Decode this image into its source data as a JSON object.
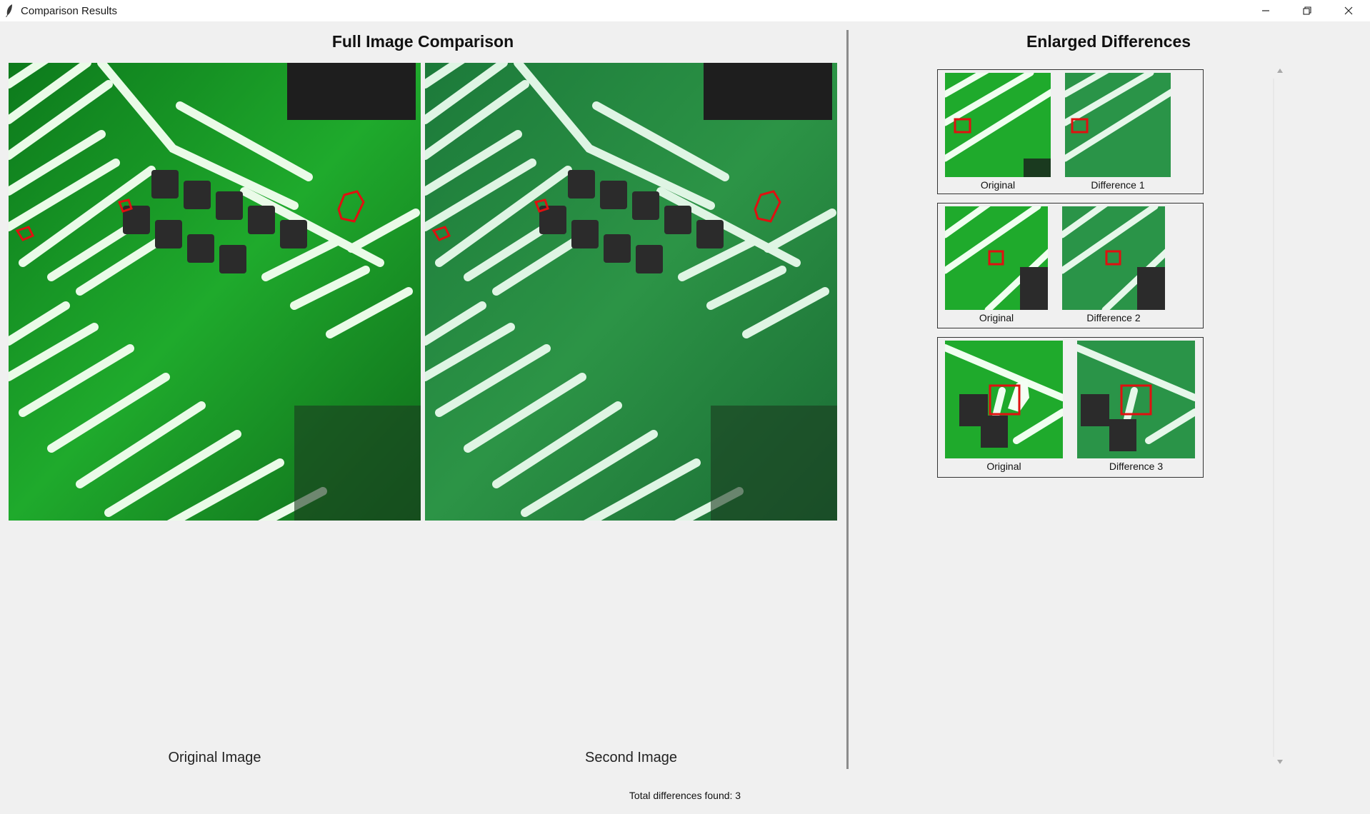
{
  "window": {
    "title": "Comparison Results"
  },
  "left_panel": {
    "title": "Full Image Comparison",
    "original_caption": "Original Image",
    "second_caption": "Second Image"
  },
  "right_panel": {
    "title": "Enlarged Differences",
    "cards": [
      {
        "original_label": "Original",
        "diff_label": "Difference 1"
      },
      {
        "original_label": "Original",
        "diff_label": "Difference 2"
      },
      {
        "original_label": "Original",
        "diff_label": "Difference 3"
      }
    ]
  },
  "status": {
    "text": "Total differences found: 3"
  },
  "colors": {
    "pcb_green": "#1f9a2e",
    "pcb_green_faded": "#2e8a4a",
    "marker_red": "#e01010",
    "background": "#f0f0f0"
  },
  "icons": {
    "app": "feather-icon",
    "minimize": "minimize-icon",
    "maximize": "restore-icon",
    "close": "close-icon"
  }
}
